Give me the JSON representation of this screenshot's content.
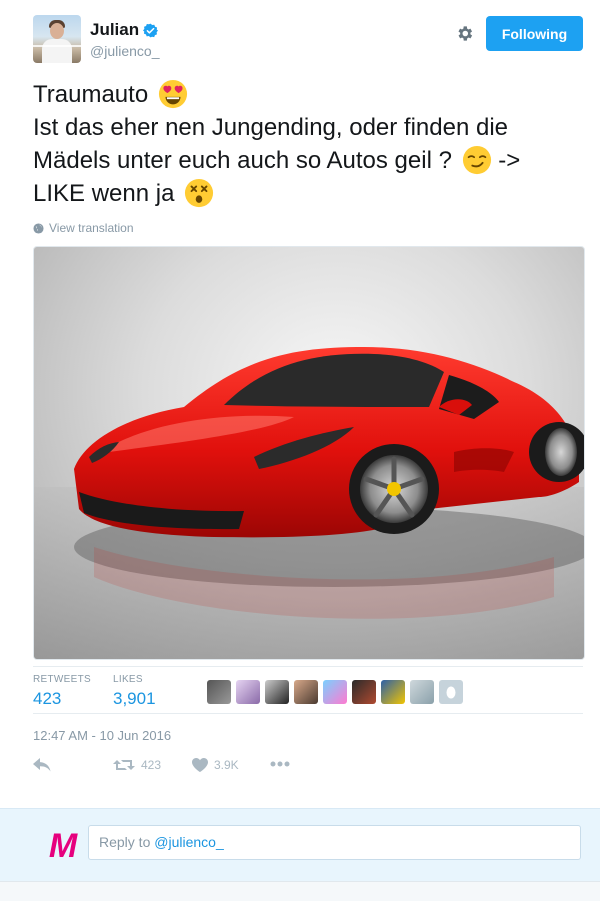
{
  "user": {
    "display_name": "Julian",
    "handle": "@julienco_",
    "verified": true
  },
  "header": {
    "follow_label": "Following",
    "settings_icon": "gear-icon"
  },
  "tweet": {
    "lines": [
      "Traumauto",
      "Ist das eher nen Jungending, oder finden die",
      "Mädels unter euch auch so Autos geil ?",
      "LIKE wenn ja"
    ],
    "line3_suffix": "->",
    "emojis": [
      "heart-eyes-emoji",
      "smirk-emoji",
      "dizzy-face-emoji"
    ],
    "translate_label": "View translation",
    "media_description_icon": "red-sports-car-photo"
  },
  "stats": {
    "retweets_label": "RETWEETS",
    "retweets_value": "423",
    "likes_label": "LIKES",
    "likes_value": "3,901"
  },
  "timestamp": "12:47 AM - 10 Jun 2016",
  "actions": {
    "reply_icon": "reply-icon",
    "retweet_icon": "retweet-icon",
    "retweet_count": "423",
    "like_icon": "heart-icon",
    "like_count": "3.9K",
    "more_icon": "more-icon"
  },
  "reply": {
    "prefix": "Reply to",
    "mention": "@julienco_",
    "logo_letter": "M"
  },
  "colors": {
    "accent": "#1da1f2",
    "link": "#1b95e0",
    "muted": "#8899a6",
    "brand_m": "#e6007e"
  }
}
